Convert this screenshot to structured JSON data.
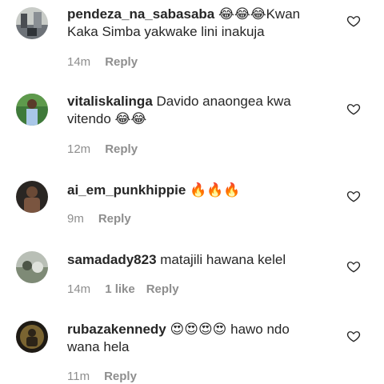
{
  "comments": [
    {
      "username": "pendeza_na_sabasaba",
      "text": "😂😂😂Kwan Kaka Simba yakwake lini inakuja",
      "time": "14m",
      "likes": "",
      "reply": "Reply"
    },
    {
      "username": "vitaliskalinga",
      "text": "Davido anaongea kwa vitendo 😂😂",
      "time": "12m",
      "likes": "",
      "reply": "Reply"
    },
    {
      "username": "ai_em_punkhippie",
      "text": "🔥🔥🔥",
      "time": "9m",
      "likes": "",
      "reply": "Reply"
    },
    {
      "username": "samadady823",
      "text": "matajili hawana kelel",
      "time": "14m",
      "likes": "1 like",
      "reply": "Reply"
    },
    {
      "username": "rubazakennedy",
      "text": "😍😍😍😍 hawo ndo wana hela",
      "time": "11m",
      "likes": "",
      "reply": "Reply"
    }
  ],
  "icons": {
    "like": "heart-outline-icon"
  },
  "colors": {
    "text": "#262626",
    "meta": "#8e8e8e"
  }
}
